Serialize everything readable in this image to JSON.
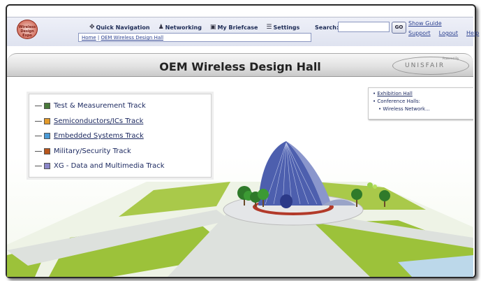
{
  "logo": {
    "text": "Wireless Design Expo"
  },
  "nav": {
    "items": [
      {
        "label": "Quick Navigation",
        "icon": "compass-icon",
        "glyph": "✥"
      },
      {
        "label": "Networking",
        "icon": "people-icon",
        "glyph": "♟"
      },
      {
        "label": "My Briefcase",
        "icon": "briefcase-icon",
        "glyph": "▣"
      },
      {
        "label": "Settings",
        "icon": "settings-icon",
        "glyph": "☰"
      }
    ],
    "breadcrumb": {
      "home": "Home",
      "separator": " | ",
      "current": "OEM Wireless Design Hall"
    },
    "search": {
      "label": "Search:",
      "value": "",
      "button": "GO"
    },
    "links": {
      "show_guide": "Show Guide",
      "support": "Support",
      "logout": "Logout",
      "help": "Help"
    }
  },
  "title": {
    "text": "OEM Wireless Design Hall"
  },
  "brand": {
    "powered_by": "Powered By",
    "name": "UNISFAIR"
  },
  "tracks": [
    {
      "label": "Test & Measurement Track",
      "color": "#4a7a3a",
      "underline": false
    },
    {
      "label": "Semiconductors/ICs Track",
      "color": "#e39a2a",
      "underline": true
    },
    {
      "label": "Embedded Systems Track",
      "color": "#4a9ad6",
      "underline": true
    },
    {
      "label": "Military/Security Track",
      "color": "#b8561c",
      "underline": false
    },
    {
      "label": "XG - Data and Multimedia Track",
      "color": "#8a86c8",
      "underline": false
    }
  ],
  "locations": {
    "exhibition_hall": "Exhibition Hall",
    "conference_halls": "Conference Halls:",
    "wireless_networks": "Wireless Network..."
  },
  "colors": {
    "accent": "#1c2960",
    "grass": "#9cc23a",
    "path": "#d8dcd8",
    "building": "#4a5aa8"
  }
}
